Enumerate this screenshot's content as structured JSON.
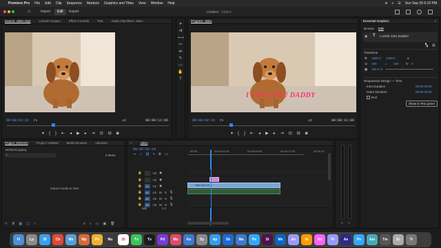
{
  "menubar": {
    "apple": "",
    "app": "Premiere Pro",
    "items": [
      "File",
      "Edit",
      "Clip",
      "Sequence",
      "Markers",
      "Graphics and Titles",
      "View",
      "Window",
      "Help"
    ],
    "datetime": "Sun Sep 25  6:10 PM"
  },
  "header": {
    "workspaces": [
      "Import",
      "Edit",
      "Export"
    ],
    "title": "Untitled",
    "subtitle": "- Edited"
  },
  "source": {
    "tabs": [
      "Source: video.mp4",
      "Lumetri Scopes",
      "Effect Controls",
      "Text",
      "Audio Clip Mixer: video"
    ],
    "timecode": "00:00:01:22",
    "fit": "Fit",
    "ratio": "1/2",
    "duration": "00:00:11:06"
  },
  "program": {
    "tab": "Program: video",
    "timecode": "00:00:02:24",
    "fit": "Fit",
    "ratio": "1/2",
    "duration": "00:00:11:06",
    "overlay_text": "I LOVE YOU DADDY"
  },
  "project": {
    "tabs": [
      "Project: DOGGO",
      "Project: Untitled",
      "Media Browser",
      "Libraries"
    ],
    "file": "DOGGO.prproj",
    "items_count": "0 items",
    "import_prompt": "Import media to start"
  },
  "timeline": {
    "tab": "video",
    "timecode": "00:00:02:24",
    "ruler_ticks": [
      ":00:00",
      "00:00:04:00",
      "00:00:08:00",
      "00:00:12:00",
      "00:00:16"
    ],
    "video_tracks": [
      "V3",
      "V2",
      "V1"
    ],
    "audio_tracks": [
      "A1",
      "A2",
      "A3"
    ],
    "mix_label": "Mix",
    "mix_value": "0.0",
    "clip_v1_label": "video.mp4 [V]",
    "meter_labels": [
      "S",
      "S"
    ]
  },
  "essential_graphics": {
    "title": "Essential Graphics",
    "tabs": [
      "Browse",
      "Edit"
    ],
    "layer_text": "I LOVE YOU DADDY",
    "transform_label": "Transform",
    "position_x": "1920.0",
    "position_y": "1080.0",
    "scale": "100",
    "rotation": "0",
    "opacity": "100.0 %",
    "responsive_label": "Responsive Design — Time",
    "intro_label": "Intro Duration",
    "intro_value": "00:00:00:00",
    "outro_label": "Outro Duration",
    "outro_value": "00:00:00:00",
    "roll_label": "Roll",
    "show_button": "Show in Text panel"
  },
  "dock": {
    "apps": [
      "Fi",
      "Lp",
      "Sf",
      "Ch",
      "Ms",
      "Mp",
      "Ph",
      "Mu",
      "25",
      "Tx",
      "Tv",
      "Pd",
      "Mu",
      "Ka",
      "Sy",
      "Ap",
      "Sh",
      "Ma",
      "Ps",
      "Sl",
      "Ms",
      "Ae",
      "Ai",
      "Xd",
      "Pr",
      "Ae",
      "Ps",
      "Am",
      "Tm",
      "Sc",
      "Tr"
    ],
    "colors": [
      "#4a90d9",
      "#8a8a8a",
      "#3aa0f0",
      "#e0483a",
      "#5a9ed6",
      "#d46a3a",
      "#f0b030",
      "#3a3a3a",
      "#ffffff",
      "#3ac35a",
      "#1c1c1c",
      "#7a3ad6",
      "#e04a6a",
      "#3a7ad6",
      "#8a8a8a",
      "#2f9ef0",
      "#1a6ad6",
      "#3a7ad6",
      "#31a8ff",
      "#4a154b",
      "#0a66c2",
      "#9999ff",
      "#ff9a00",
      "#ff61f6",
      "#9999ff",
      "#2a2a8a",
      "#31a8ff",
      "#4ab",
      "#555",
      "#aaa",
      "#777"
    ]
  }
}
